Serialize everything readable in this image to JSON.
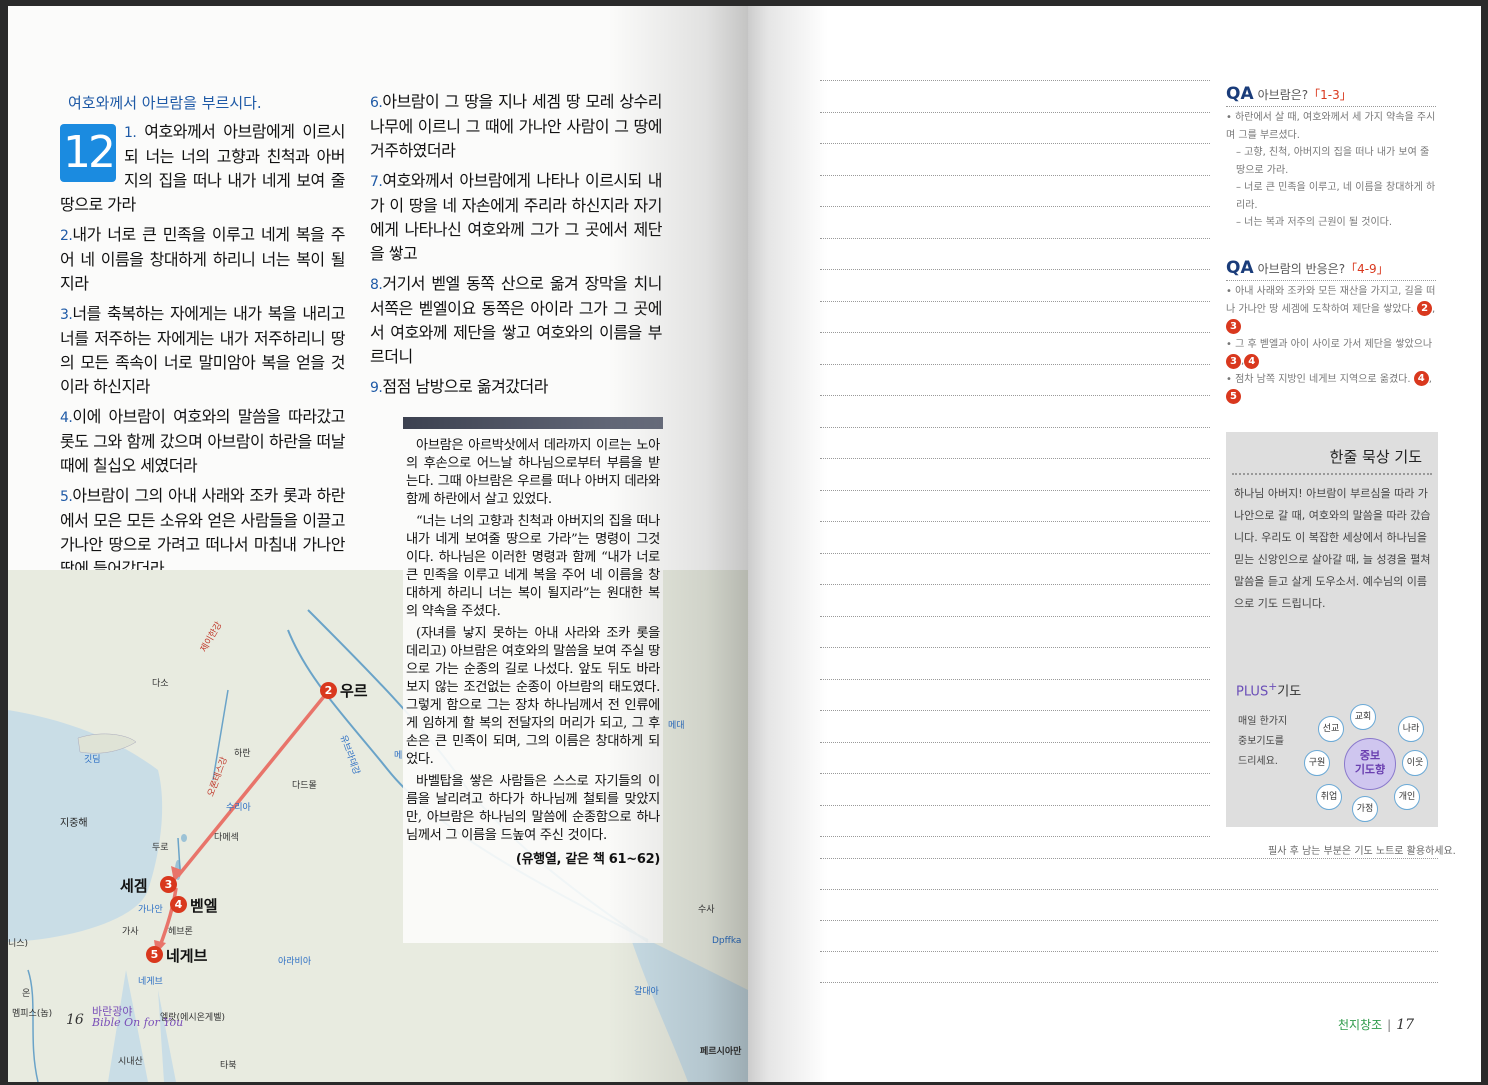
{
  "left_page": {
    "section_title": "여호와께서 아브람을 부르시다.",
    "chapter": "12",
    "verses_col1": [
      {
        "num": "1.",
        "text": " 여호와께서 아브람에게 이르시되 너는 너의 고향과 친척과 아버지의 집을 떠나 내가 네게 보여 줄 땅으로 가라"
      },
      {
        "num": "2.",
        "text": "내가 너로 큰 민족을 이루고 네게 복을 주어 네 이름을 창대하게 하리니 너는 복이 될지라"
      },
      {
        "num": "3.",
        "text": "너를 축복하는 자에게는 내가 복을 내리고 너를 저주하는 자에게는 내가 저주하리니 땅의 모든 족속이 너로 말미암아 복을 얻을 것이라 하신지라"
      },
      {
        "num": "4.",
        "text": "이에 아브람이 여호와의 말씀을 따라갔고 롯도 그와 함께 갔으며 아브람이 하란을 떠날 때에 칠십오 세였더라"
      },
      {
        "num": "5.",
        "text": "아브람이 그의 아내 사래와 조카 롯과 하란에서 모은 모든 소유와 얻은 사람들을 이끌고 가나안 땅으로 가려고 떠나서 마침내 가나안 땅에 들어갔더라"
      }
    ],
    "verses_col2": [
      {
        "num": "6.",
        "text": "아브람이 그 땅을 지나 세겜 땅 모레 상수리나무에 이르니 그 때에 가나안 사람이 그 땅에 거주하였더라"
      },
      {
        "num": "7.",
        "text": "여호와께서 아브람에게 나타나 이르시되 내가 이 땅을 네 자손에게 주리라 하신지라 자기에게 나타나신 여호와께 그가 그 곳에서 제단을 쌓고"
      },
      {
        "num": "8.",
        "text": "거기서 벧엘 동쪽 산으로 옮겨 장막을 치니 서쪽은 벧엘이요 동쪽은 아이라 그가 그 곳에서 여호와께 제단을 쌓고 여호와의 이름을 부르더니"
      },
      {
        "num": "9.",
        "text": "점점 남방으로 옮겨갔더라"
      }
    ],
    "commentary": {
      "paragraphs": [
        "아브람은 아르박삿에서 데라까지 이르는 노아의 후손으로 어느날 하나님으로부터 부름을 받는다. 그때 아브람은 우르를 떠나 아버지 데라와 함께 하란에서 살고 있었다.",
        "“너는 너의 고향과 친척과 아버지의 집을 떠나 내가 네게 보여줄 땅으로 가라”는 명령이 그것이다. 하나님은 이러한 명령과 함께 “내가 너로 큰 민족을 이루고 네게 복을 주어 네 이름을 창대하게 하리니 너는 복이 될지라”는 원대한 복의 약속을 주셨다.",
        "(자녀를 낳지 못하는 아내 사라와 조카 롯을 데리고) 아브람은 여호와의 말씀을 보여 주실 땅으로 가는 순종의 길로 나섰다. 앞도 뒤도 바라보지 않는 조건없는 순종이 아브람의 태도였다. 그렇게 함으로 그는 장차 하나님께서 전 인류에게 임하게 할 복의 전달자의 머리가 되고, 그 후손은 큰 민족이 되며, 그의 이름은 창대하게 되었다.",
        "바벨탑을 쌓은 사람들은 스스로 자기들의 이름을 날리려고 하다가 하나님께 철퇴를 맞았지만, 아브람은 하나님의 말씀에 순종함으로 하나님께서 그 이름을 드높여 주신 것이다."
      ],
      "source": "(유행열, 같은 책 61~62)"
    },
    "map": {
      "stops": [
        {
          "n": "2",
          "label": "우르"
        },
        {
          "n": "3",
          "label": "세겜"
        },
        {
          "n": "4",
          "label": "벧엘"
        },
        {
          "n": "5",
          "label": "네게브"
        }
      ],
      "places": {
        "dasu": "다소",
        "haran": "하란",
        "dadmol": "다드몰",
        "duro": "두로",
        "damascus": "다메섹",
        "gasa": "가사",
        "hebron": "헤브론",
        "ganan": "가나안",
        "on": "온",
        "memphis": "멤피스(놉)",
        "elat": "엘랏(에시온게벨)",
        "sinai": "시내산",
        "tabuk": "타북",
        "susa": "수사",
        "dpffka": "Dpffka"
      },
      "regions": {
        "euphrates": "유브라데강",
        "jehinam": "제이한강",
        "orontes": "오론테스강",
        "syria": "수리아",
        "cyprus": "깃딤",
        "mediterranean": "지중해",
        "media": "메대",
        "arabia": "아라비아",
        "negev_region": "네게브",
        "wilderness": "바란광야",
        "chaldea": "갈대아",
        "persian_gulf": "페르시아만",
        "egypt_partial": "니스)",
        "me": "메"
      }
    },
    "page_number": "16",
    "footer_brand": "Bible On for You"
  },
  "right_page": {
    "qa1": {
      "label": "QA",
      "title": "아브람은?",
      "ref": "「1-3」",
      "lines": [
        "• 하란에서 살 때, 여호와께서 세 가지 약속을 주시며 그를 부르셨다.",
        "– 고향, 친척, 아버지의 집을 떠나 내가 보여 줄 땅으로 가라.",
        "– 너로 큰 민족을 이루고, 네 이름을 창대하게 하리라.",
        "– 너는 복과 저주의 근원이 될 것이다."
      ]
    },
    "qa2": {
      "label": "QA",
      "title": "아브람의 반응은?",
      "ref": "「4-9」",
      "items": [
        {
          "text": "• 아내 사래와 조카와 모든 재산을 가지고, 길을 떠나 가나안 땅 세겜에 도착하여 제단을 쌓았다.",
          "tags": [
            "2",
            "3"
          ]
        },
        {
          "text": "• 그 후 벧엘과 아이 사이로 가서 제단을 쌓았으나",
          "tags": [
            "3",
            "4"
          ]
        },
        {
          "text": "• 점차 남쪽 지방인 네게브 지역으로 옮겼다.",
          "tags": [
            "4",
            "5"
          ]
        }
      ]
    },
    "prayer": {
      "title": "한줄 묵상 기도",
      "text": "하나님 아버지! 아브람이 부르심을 따라 가나안으로 갈 때, 여호와의 말씀을 따라 갔습니다. 우리도 이 복잡한 세상에서 하나님을 믿는 신앙인으로 살아갈 때, 늘 성경을 펼쳐 말씀을 듣고 살게 도우소서. 예수님의 이름으로 기도 드립니다.",
      "plus_label": "PLUS",
      "plus_sup": "+",
      "plus_suffix": "기도",
      "plus_text": [
        "매일 한가지",
        "중보기도를",
        "드리세요."
      ],
      "center": [
        "중보",
        "기도향"
      ],
      "bubbles": [
        "교회",
        "나라",
        "이웃",
        "개인",
        "가정",
        "취업",
        "구원",
        "선교"
      ]
    },
    "hint": "필사 후 남는 부분은 기도 노트로 활용하세요.",
    "footer_title": "천지창조",
    "footer_sep": "|",
    "page_number": "17"
  }
}
